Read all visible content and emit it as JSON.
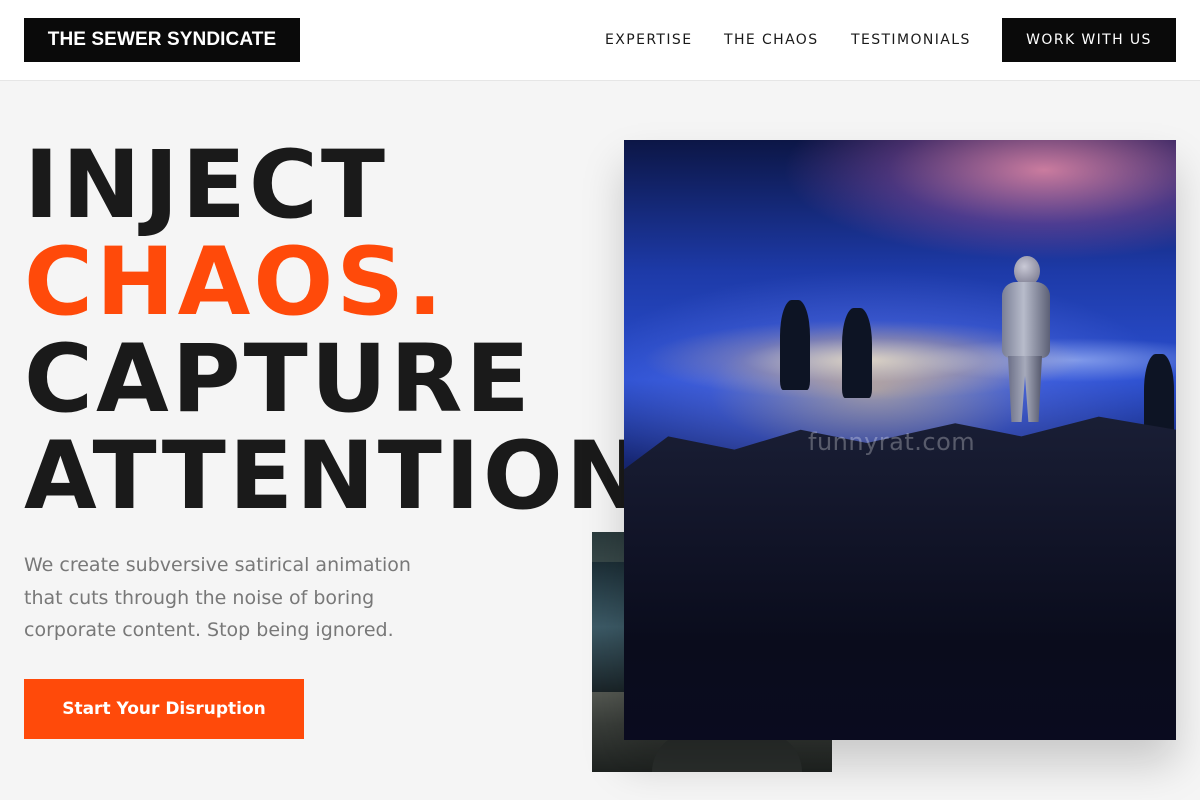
{
  "header": {
    "logo": "THE SEWER SYNDICATE",
    "nav": {
      "expertise": "EXPERTISE",
      "the_chaos": "THE CHAOS",
      "testimonials": "TESTIMONIALS"
    },
    "cta": "WORK WITH US"
  },
  "hero": {
    "headline": {
      "line1": "INJECT",
      "line2": "CHAOS.",
      "line3": "CAPTURE",
      "line4": "ATTENTION"
    },
    "subtitle": "We create subversive satirical animation that cuts through the noise of boring corporate content. Stop being ignored.",
    "cta": "Start Your Disruption"
  },
  "images": {
    "main_watermark": "funnyrat.com"
  },
  "colors": {
    "accent": "#ff4a0a",
    "dark": "#0a0a0a",
    "background": "#f5f5f5",
    "text_muted": "#787878"
  }
}
